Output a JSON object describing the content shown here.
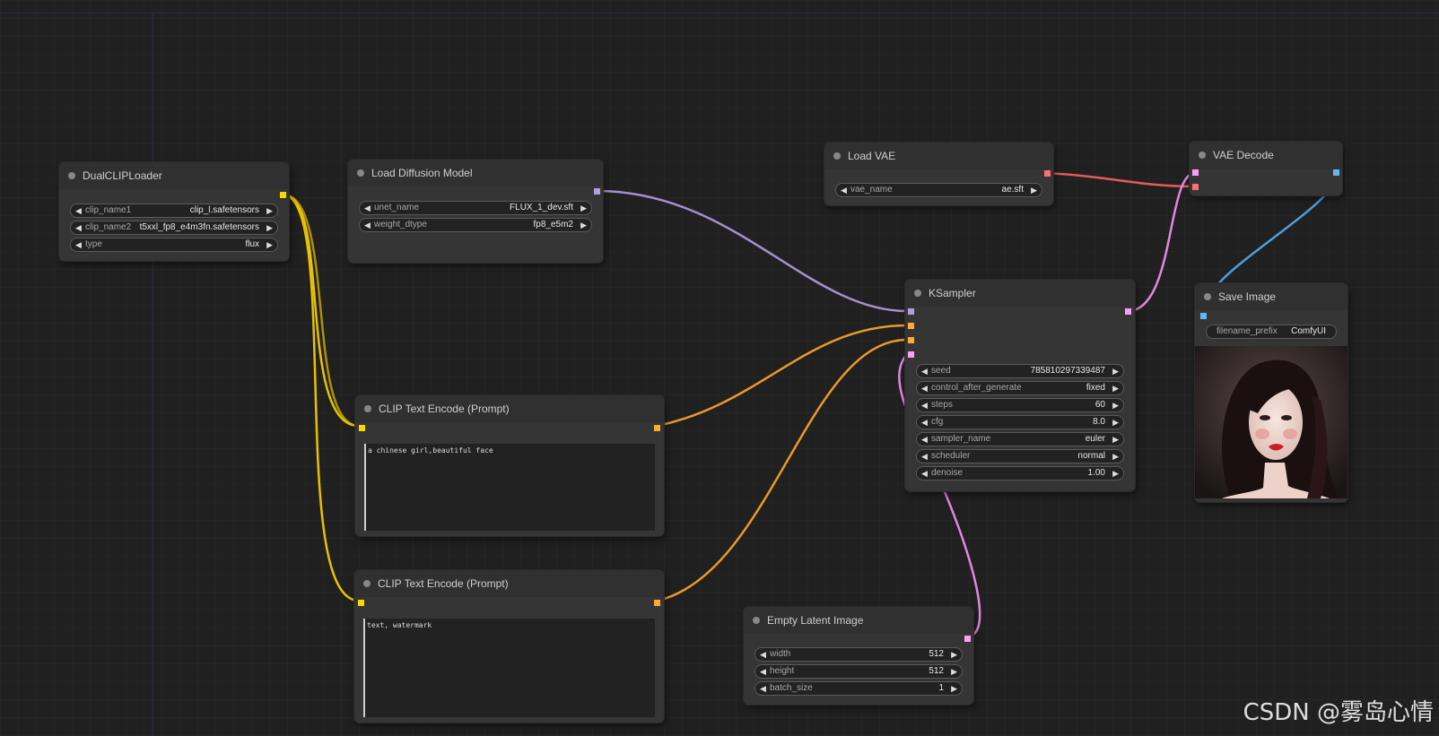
{
  "colors": {
    "clip": "#ffd500",
    "model": "#b39ddb",
    "vae": "#ff6e6e",
    "conditioning": "#ffa931",
    "latent": "#ff9cf9",
    "image": "#64b5f6"
  },
  "nodes": {
    "dual_clip_loader": {
      "title": "DualCLIPLoader",
      "widgets": [
        {
          "name": "clip_name1",
          "value": "clip_l.safetensors"
        },
        {
          "name": "clip_name2",
          "value": "t5xxl_fp8_e4m3fn.safetensors"
        },
        {
          "name": "type",
          "value": "flux"
        }
      ]
    },
    "load_diffusion_model": {
      "title": "Load Diffusion Model",
      "widgets": [
        {
          "name": "unet_name",
          "value": "FLUX_1_dev.sft"
        },
        {
          "name": "weight_dtype",
          "value": "fp8_e5m2"
        }
      ]
    },
    "load_vae": {
      "title": "Load VAE",
      "widgets": [
        {
          "name": "vae_name",
          "value": "ae.sft"
        }
      ]
    },
    "vae_decode": {
      "title": "VAE Decode"
    },
    "ksampler": {
      "title": "KSampler",
      "widgets": [
        {
          "name": "seed",
          "value": "785810297339487"
        },
        {
          "name": "control_after_generate",
          "value": "fixed"
        },
        {
          "name": "steps",
          "value": "60"
        },
        {
          "name": "cfg",
          "value": "8.0"
        },
        {
          "name": "sampler_name",
          "value": "euler"
        },
        {
          "name": "scheduler",
          "value": "normal"
        },
        {
          "name": "denoise",
          "value": "1.00"
        }
      ]
    },
    "save_image": {
      "title": "Save Image",
      "widgets": [
        {
          "name": "filename_prefix",
          "value": "ComfyUI"
        }
      ]
    },
    "clip_text_encode_pos": {
      "title": "CLIP Text Encode (Prompt)",
      "text": "a chinese girl,beautiful face"
    },
    "clip_text_encode_neg": {
      "title": "CLIP Text Encode (Prompt)",
      "text": "text, watermark"
    },
    "empty_latent": {
      "title": "Empty Latent Image",
      "widgets": [
        {
          "name": "width",
          "value": "512"
        },
        {
          "name": "height",
          "value": "512"
        },
        {
          "name": "batch_size",
          "value": "1"
        }
      ]
    }
  },
  "watermark": "CSDN @雾岛心情"
}
